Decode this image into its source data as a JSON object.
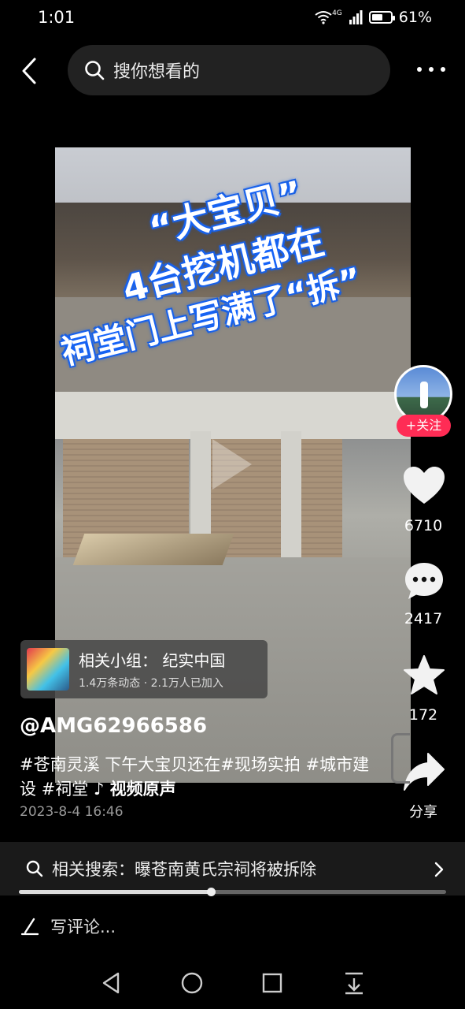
{
  "status": {
    "time": "1:01",
    "network": "4G",
    "battery": "61%",
    "battery_level": 0.61
  },
  "search": {
    "placeholder": "搜你想看的"
  },
  "video": {
    "overlay_lines": [
      "“大宝贝”",
      "4台挖机都在",
      "祠堂门上写满了“拆”"
    ]
  },
  "actions": {
    "follow_label": "+关注",
    "likes": "6710",
    "comments": "2417",
    "favorites": "172",
    "share_label": "分享"
  },
  "group": {
    "title": "相关小组：  纪实中国",
    "subtitle": "1.4万条动态 · 2.1万人已加入"
  },
  "author": "@AMG62966586",
  "caption": {
    "text": "#苍南灵溪 下午大宝贝还在#现场实拍 #城市建设 #祠堂",
    "music": "♪ 视频原声"
  },
  "date": "2023-8-4 16:46",
  "related": {
    "label": "相关搜索：曝苍南黄氏宗祠将被拆除"
  },
  "progress": {
    "fraction": 0.45
  },
  "comment_input": {
    "placeholder": "写评论..."
  },
  "icons": [
    "back-icon",
    "search-icon",
    "more-icon",
    "heart-icon",
    "comment-icon",
    "star-icon",
    "share-icon",
    "chevron-right-icon",
    "pen-icon",
    "nav-back-icon",
    "nav-home-icon",
    "nav-recents-icon",
    "nav-menu-icon"
  ]
}
